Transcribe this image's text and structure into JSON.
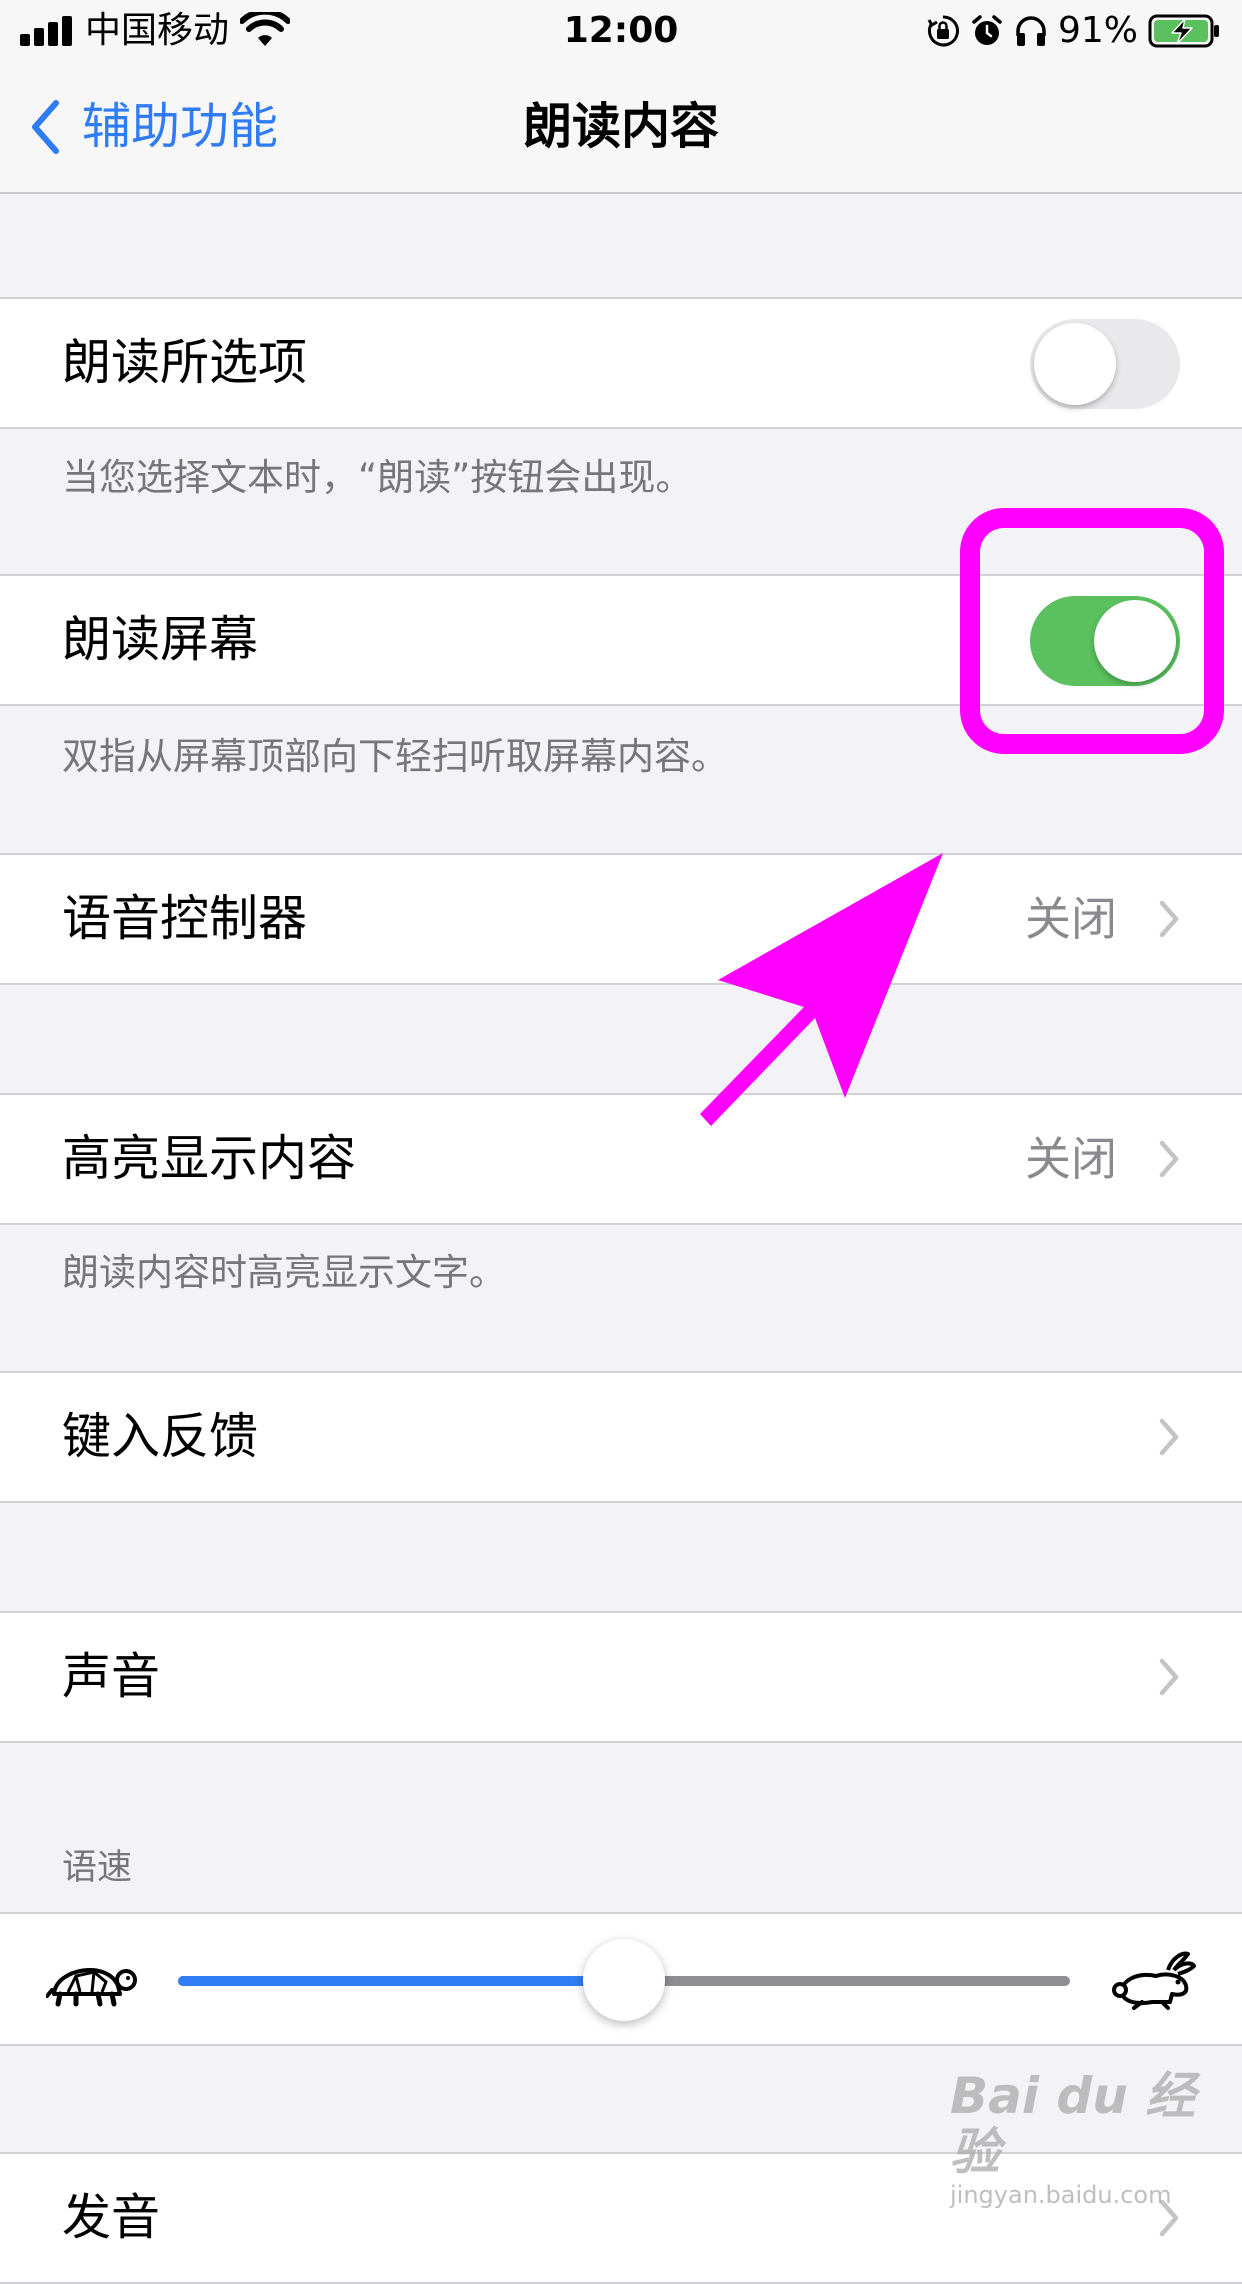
{
  "status_bar": {
    "carrier": "中国移动",
    "time": "12:00",
    "battery_percent": "91%"
  },
  "nav": {
    "back_label": "辅助功能",
    "title": "朗读内容"
  },
  "rows": {
    "speak_selection": {
      "label": "朗读所选项",
      "enabled": false,
      "footer": "当您选择文本时，“朗读”按钮会出现。"
    },
    "speak_screen": {
      "label": "朗读屏幕",
      "enabled": true,
      "footer": "双指从屏幕顶部向下轻扫听取屏幕内容。"
    },
    "speech_controller": {
      "label": "语音控制器",
      "value": "关闭"
    },
    "highlight_content": {
      "label": "高亮显示内容",
      "value": "关闭",
      "footer": "朗读内容时高亮显示文字。"
    },
    "typing_feedback": {
      "label": "键入反馈"
    },
    "voices": {
      "label": "声音"
    },
    "pronunciations": {
      "label": "发音"
    }
  },
  "speaking_rate": {
    "header": "语速",
    "value_fraction": 0.5
  },
  "colors": {
    "accent": "#2f7cf6",
    "toggle_on": "#5ac15e",
    "annotation": "#ff00ff"
  },
  "icons": {
    "back": "chevron-left-icon",
    "disclosure": "chevron-right-icon",
    "slow": "turtle-icon",
    "fast": "rabbit-icon"
  },
  "watermark": {
    "main": "Bai du 经验",
    "sub": "jingyan.baidu.com"
  }
}
